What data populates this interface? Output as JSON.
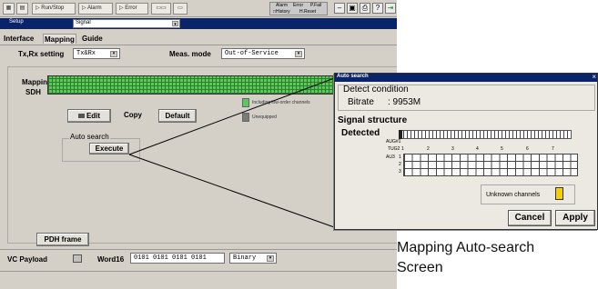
{
  "toolbar": {
    "run_stop": "Run/Stop",
    "alarm": "Alarm",
    "error": "Error",
    "status": {
      "alarm": "Alarm",
      "error": "Error",
      "pfail": "P.Fail",
      "history": "History",
      "h_reset": "H.Reset"
    }
  },
  "window": {
    "title": "Setup",
    "mode_select": "Signal"
  },
  "tabs": [
    "Interface",
    "Mapping",
    "Guide"
  ],
  "txrx": {
    "label": "Tx,Rx setting",
    "value": "Tx&Rx"
  },
  "meas_mode": {
    "label": "Meas. mode",
    "value": "Out-of-Service"
  },
  "mapping": {
    "label_line1": "Mapping",
    "label_line2": "SDH",
    "edit": "Edit",
    "copy": "Copy",
    "default": "Default",
    "legend_including": "Including low-order channels",
    "legend_unequipped": "Unequipped",
    "auto_search_label": "Auto search",
    "execute": "Execute"
  },
  "pdh_frame": "PDH frame",
  "vc_payload": {
    "label": "VC Payload",
    "word_label": "Word16",
    "word_value": "0101 0101 0101 0101",
    "format": "Binary"
  },
  "dialog": {
    "title": "Auto search",
    "detect_condition": "Detect condition",
    "bitrate_label": "Bitrate",
    "bitrate_value": ": 9953M",
    "signal_structure": "Signal structure",
    "detected": "Detected",
    "aug_label": "AUG#1",
    "tug2_label": "TUG2",
    "au3_label": "AU3",
    "row_labels": [
      "1",
      "2",
      "3"
    ],
    "tug_numbers": [
      "1",
      "2",
      "3",
      "4",
      "5",
      "6",
      "7"
    ],
    "unknown_channels": "Unknown channels",
    "cancel": "Cancel",
    "apply": "Apply"
  },
  "caption": {
    "line1": "Mapping Auto-search",
    "line2": "Screen"
  },
  "colors": {
    "mapping_grid": "#5bc85b",
    "legend_including": "#5bc85b",
    "legend_unequipped": "#7a7a7a",
    "unknown_channels": "#f5d000",
    "title_bar": "#0a246a"
  }
}
